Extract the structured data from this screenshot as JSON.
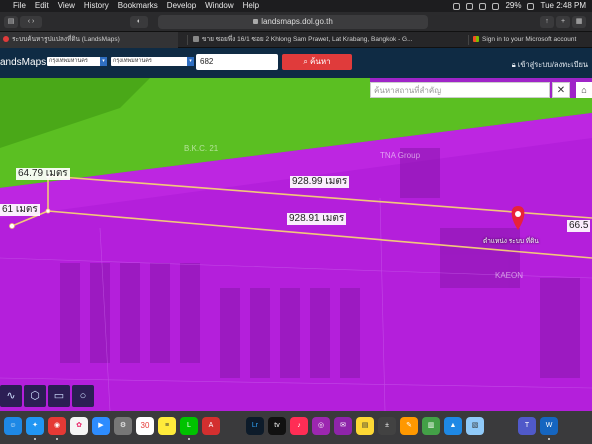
{
  "menubar": {
    "items": [
      "File",
      "Edit",
      "View",
      "History",
      "Bookmarks",
      "Develop",
      "Window",
      "Help"
    ],
    "battery": "29%",
    "clock": "Tue 2:48 PM"
  },
  "browser": {
    "url": "landsmaps.dol.go.th",
    "tabs": [
      {
        "label": "ระบบค้นหารูปแปลงที่ดิน (LandsMaps)",
        "icon": "pin-icon"
      },
      {
        "label": "ขาย ซอยพึ่ง 16/1 ซอย 2 Khlong Sam Prawet, Lat Krabang, Bangkok - G...",
        "icon": "page-icon"
      },
      {
        "label": "Sign in to your Microsoft account",
        "icon": "microsoft-icon"
      }
    ]
  },
  "app": {
    "logo": "andsMaps",
    "province": "กรุงเทพมหานคร",
    "district": "กรุงเทพมหานคร",
    "parcel_number": "682",
    "search_label": "ค้นหา",
    "login_label": "เข้าสู่ระบบ/ลงทะเบียน"
  },
  "map": {
    "place_search_placeholder": "ค้นหาสถานที่สำคัญ",
    "distances": [
      "64.79 เมตร",
      "928.99 เมตร",
      "61 เมตร",
      "928.91 เมตร",
      "66.5"
    ],
    "pin_label": "ตำแหน่ง ระบบ ที่ดิน",
    "labels": [
      "B.K.C. 21",
      "TNA Group",
      "KAEON"
    ],
    "tools": [
      "measure-icon",
      "polygon-icon",
      "rectangle-icon",
      "circle-icon"
    ]
  },
  "dock": {
    "apps": [
      "Finder",
      "Safari",
      "Chrome",
      "Photos",
      "Zoom",
      "Settings",
      "Calendar",
      "Notes",
      "LINE",
      "PDF",
      "Lr",
      "TV",
      "Music",
      "Podcasts",
      "Messenger",
      "Stickies",
      "Calculator",
      "Pages",
      "Numbers",
      "Keynote",
      "Preview",
      "Teams",
      "Word"
    ],
    "calendar_day": "30"
  },
  "colors": {
    "header_bg": "#0f2b44",
    "search_button": "#e03b3b",
    "zone_green": "#56c21a",
    "zone_magenta": "#b01ed8",
    "measure_line": "#f2c87a"
  }
}
